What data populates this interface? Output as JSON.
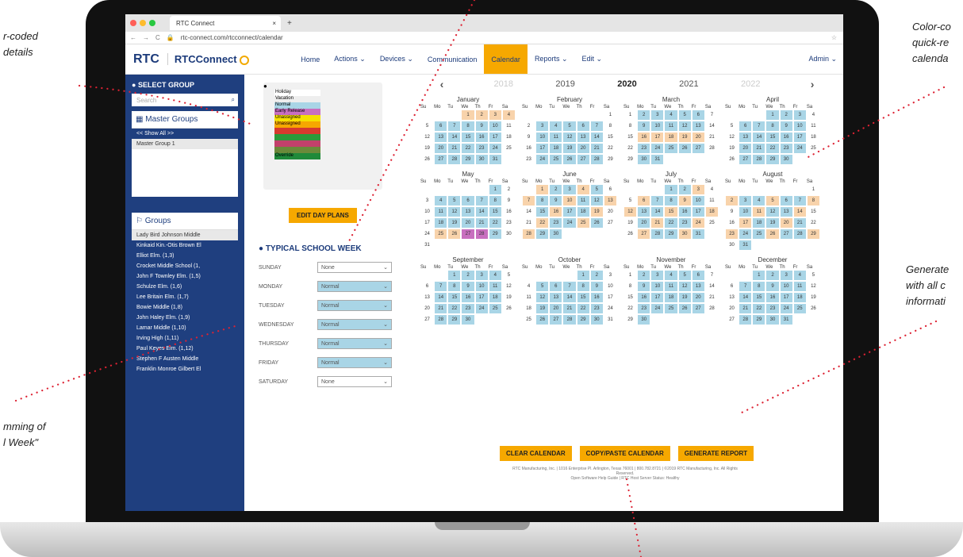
{
  "callouts": {
    "tl": "r-coded\ndetails",
    "tr": "Color-co\nquick-re\ncalenda",
    "mr": "Generate\nwith all c\ninformati",
    "bl": "mming of\nl Week\""
  },
  "browser": {
    "tab": "RTC Connect",
    "url": "rtc-connect.com/rtcconnect/calendar"
  },
  "header": {
    "logo": "RTC",
    "logo2": "RTCConnect",
    "menu": [
      "Home",
      "Actions ⌄",
      "Devices ⌄",
      "Communication",
      "Calendar",
      "Reports ⌄",
      "Edit ⌄"
    ],
    "active": 4,
    "admin": "Admin ⌄"
  },
  "sidebar": {
    "select_group": "SELECT GROUP",
    "search": "Search",
    "master_groups": "Master Groups",
    "master_items": [
      "<< Show All >>",
      "Master Group 1"
    ],
    "groups_title": "Groups",
    "groups": [
      "Lady Bird Johnson Middle",
      "Kinkaid Kin.-Otis Brown El",
      "Elliot Elm. (1,3)",
      "Crocket Middle School (1,",
      "John F Townley Elm. (1,5)",
      "Schulze Elm. (1,6)",
      "Lee Britain Elm. (1,7)",
      "Bowie Middle (1,8)",
      "John Haley Elm. (1,9)",
      "Lamar Middle (1,10)",
      "Irving High (1,11)",
      "Paul Keyes Elm. (1,12)",
      "Stephen F Austen Middle",
      "Franklin Monroe Gilbert El"
    ]
  },
  "legend": [
    {
      "label": "Holiday",
      "color": "#ffffff"
    },
    {
      "label": "Vacation",
      "color": "#eeeeee"
    },
    {
      "label": "Normal",
      "color": "#a9d5e6"
    },
    {
      "label": "Early Release",
      "color": "#c86fbf"
    },
    {
      "label": "Unassigned",
      "color": "#f6e000"
    },
    {
      "label": "Unassigned",
      "color": "#f6a800"
    },
    {
      "label": "",
      "color": "#d63a2e"
    },
    {
      "label": "",
      "color": "#2a9a3a"
    },
    {
      "label": "",
      "color": "#c2416b"
    },
    {
      "label": "",
      "color": "#6a8a3a"
    },
    {
      "label": "Override",
      "color": "#1f8a3a"
    }
  ],
  "edit_day_plans": "EDIT DAY PLANS",
  "week": {
    "title": "TYPICAL SCHOOL WEEK",
    "days": [
      {
        "d": "SUNDAY",
        "v": "None"
      },
      {
        "d": "MONDAY",
        "v": "Normal"
      },
      {
        "d": "TUESDAY",
        "v": "Normal"
      },
      {
        "d": "WEDNESDAY",
        "v": "Normal"
      },
      {
        "d": "THURSDAY",
        "v": "Normal"
      },
      {
        "d": "FRIDAY",
        "v": "Normal"
      },
      {
        "d": "SATURDAY",
        "v": "None"
      }
    ]
  },
  "years": [
    "2018",
    "2019",
    "2020",
    "2021",
    "2022"
  ],
  "dow": [
    "Su",
    "Mo",
    "Tu",
    "We",
    "Th",
    "Fr",
    "Sa"
  ],
  "months": [
    {
      "name": "January",
      "start": 3,
      "len": 31
    },
    {
      "name": "February",
      "start": 6,
      "len": 29
    },
    {
      "name": "March",
      "start": 0,
      "len": 31
    },
    {
      "name": "April",
      "start": 3,
      "len": 30
    },
    {
      "name": "May",
      "start": 5,
      "len": 31
    },
    {
      "name": "June",
      "start": 1,
      "len": 30
    },
    {
      "name": "July",
      "start": 3,
      "len": 31
    },
    {
      "name": "August",
      "start": 6,
      "len": 31
    },
    {
      "name": "September",
      "start": 2,
      "len": 30
    },
    {
      "name": "October",
      "start": 4,
      "len": 31
    },
    {
      "name": "November",
      "start": 0,
      "len": 30
    },
    {
      "name": "December",
      "start": 2,
      "len": 31
    }
  ],
  "buttons": {
    "clear": "CLEAR CALENDAR",
    "copy": "COPY/PASTE CALENDAR",
    "report": "GENERATE REPORT"
  },
  "footer": "RTC Manufacturing, Inc. | 1016 Enterprise Pl. Arlington, Texas 76001 | 800.782.8721 | ©2019 RTC Manufacturing, Inc. All Rights Reserved.",
  "footer2": "Open Software Help Guide | RTC Host Server Status: Healthy"
}
